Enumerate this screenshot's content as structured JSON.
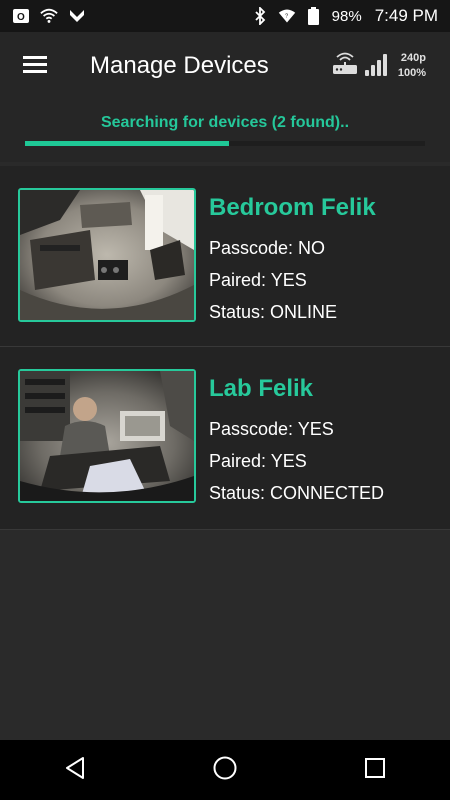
{
  "status_bar": {
    "battery": "98%",
    "time": "7:49 PM"
  },
  "app_bar": {
    "title": "Manage Devices",
    "resolution": "240p",
    "signal": "100%"
  },
  "search": {
    "text": "Searching for devices (2 found)..",
    "progress": 0.51
  },
  "devices": [
    {
      "name": "Bedroom Felik",
      "passcode": "Passcode: NO",
      "paired": "Paired: YES",
      "status": "Status: ONLINE"
    },
    {
      "name": "Lab Felik",
      "passcode": "Passcode: YES",
      "paired": "Paired: YES",
      "status": "Status: CONNECTED"
    }
  ],
  "colors": {
    "accent": "#27c99b",
    "background": "#2a2a2a"
  }
}
